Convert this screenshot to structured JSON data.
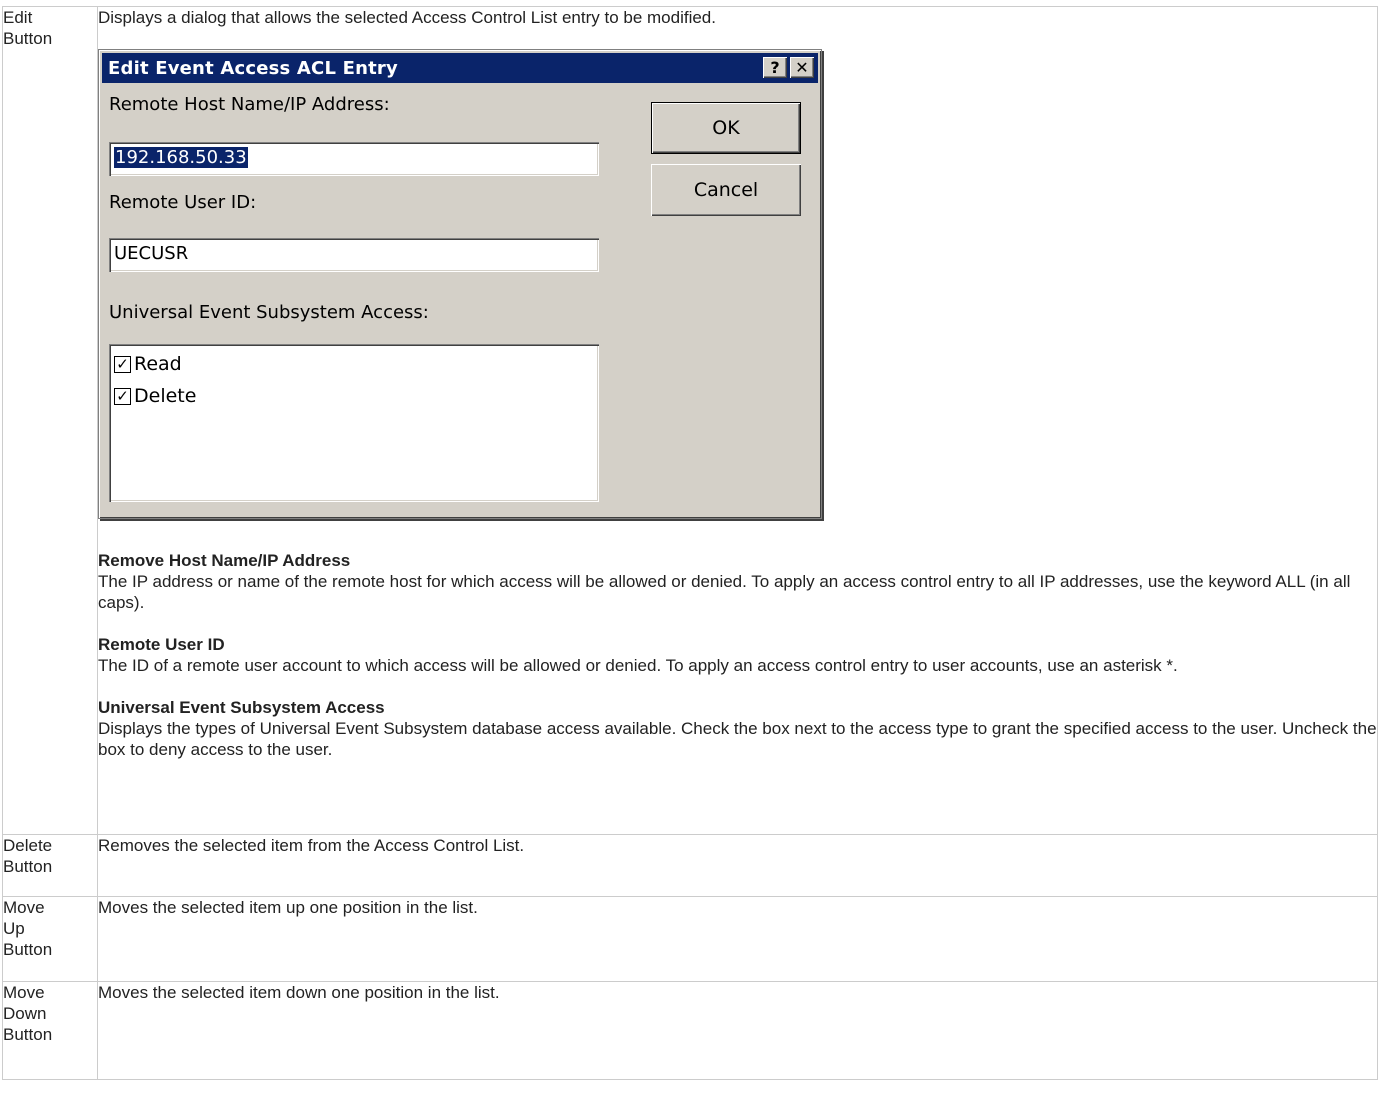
{
  "rows": [
    {
      "label": [
        "Edit",
        "Button"
      ],
      "description": "Displays a dialog that allows the selected Access Control List entry to be modified."
    },
    {
      "label": [
        "Delete",
        "Button"
      ],
      "description": "Removes the selected item from the Access Control List."
    },
    {
      "label": [
        "Move",
        "Up",
        "Button"
      ],
      "description": "Moves the selected item up one position in the list."
    },
    {
      "label": [
        "Move",
        "Down",
        "Button"
      ],
      "description": "Moves the selected item down one position in the list."
    }
  ],
  "dialog": {
    "title": "Edit Event Access ACL Entry",
    "help_icon": "help-icon",
    "close_icon": "close-icon",
    "help_glyph": "?",
    "close_glyph": "✕",
    "host_label": "Remote Host Name/IP Address:",
    "host_value": "192.168.50.33",
    "user_label": "Remote User ID:",
    "user_value": "UECUSR",
    "access_label": "Universal Event Subsystem Access:",
    "access_items": [
      {
        "label": "Read",
        "checked": true
      },
      {
        "label": "Delete",
        "checked": true
      }
    ],
    "ok_label": "OK",
    "cancel_label": "Cancel",
    "colors": {
      "titlebar": "#0a246a",
      "face": "#d4d0c8"
    }
  },
  "fields": [
    {
      "title": "Remove Host Name/IP Address",
      "text": "The IP address or name of the remote host for which access will be allowed or denied. To apply an access control entry to all IP addresses, use the keyword ALL (in all caps)."
    },
    {
      "title": "Remote User ID",
      "text": "The ID of a remote user account to which access will be allowed or denied. To apply an access control entry to user accounts, use an asterisk *."
    },
    {
      "title": "Universal Event Subsystem Access",
      "text": "Displays the types of Universal Event Subsystem database access available. Check the box next to the access type to grant the specified access to the user. Uncheck the box to deny access to the user."
    }
  ]
}
